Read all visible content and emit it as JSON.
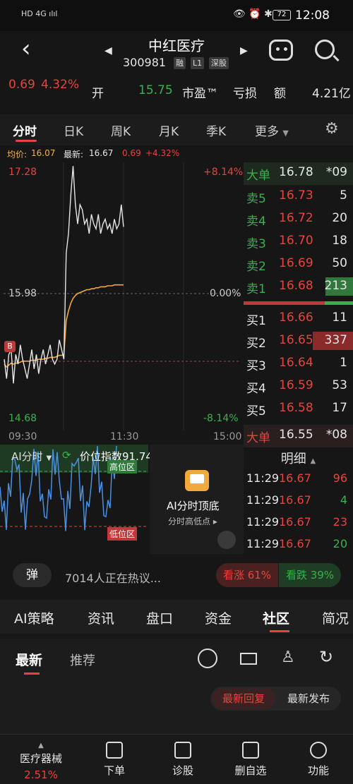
{
  "status": {
    "left_icons": "HD 4G ılıl",
    "battery": "72",
    "time": "12:08"
  },
  "header": {
    "name": "中红医疗",
    "code": "300981",
    "tags": [
      "融",
      "L1",
      "深股"
    ]
  },
  "quote": {
    "change": "0.69",
    "change_pct": "4.32%",
    "open_label": "开",
    "open_value": "15.75",
    "pe_label": "市盈™",
    "pe_value": "亏损",
    "amount_label": "额",
    "amount_value": "4.21亿"
  },
  "tabs": [
    "分时",
    "日K",
    "周K",
    "月K",
    "季K",
    "更多"
  ],
  "avg": {
    "avg_label": "均价:",
    "avg_value": "16.07",
    "latest_label": "最新:",
    "latest_value": "16.67",
    "chg": "0.69",
    "pct": "+4.32%"
  },
  "chart_data": {
    "type": "line",
    "title": "",
    "y_max": "17.28",
    "y_mid": "15.98",
    "y_min": "14.68",
    "pct_max": "+8.14%",
    "pct_mid": "0.00%",
    "pct_min": "-8.14%",
    "x_ticks": [
      "09:30",
      "11:30",
      "15:00"
    ],
    "price": [
      15.3,
      15.1,
      15.35,
      15.4,
      15.05,
      15.35,
      15.25,
      15.45,
      15.3,
      15.2,
      15.1,
      15.25,
      15.4,
      15.2,
      15.35,
      15.15,
      15.3,
      15.4,
      15.25,
      15.35,
      15.45,
      15.3,
      15.25,
      15.3,
      15.5,
      15.4,
      15.3,
      16.4,
      16.6,
      17.0,
      17.3,
      16.9,
      16.7,
      16.9,
      16.85,
      16.7,
      16.75,
      16.6,
      16.8,
      16.7,
      16.65,
      16.8,
      16.6,
      16.7,
      16.75,
      16.65,
      16.7,
      16.6,
      16.75,
      16.65,
      16.7,
      16.9,
      16.67
    ],
    "avg": [
      15.25,
      15.22,
      15.24,
      15.26,
      15.25,
      15.26,
      15.26,
      15.27,
      15.28,
      15.28,
      15.28,
      15.28,
      15.29,
      15.29,
      15.29,
      15.3,
      15.3,
      15.3,
      15.31,
      15.31,
      15.32,
      15.32,
      15.32,
      15.33,
      15.34,
      15.34,
      15.35,
      15.7,
      15.8,
      15.88,
      15.93,
      15.96,
      15.98,
      15.99,
      16.0,
      16.01,
      16.02,
      16.02,
      16.03,
      16.03,
      16.04,
      16.04,
      16.05,
      16.05,
      16.05,
      16.06,
      16.06,
      16.06,
      16.07,
      16.07,
      16.07,
      16.07,
      16.07
    ]
  },
  "orderbook": {
    "top": {
      "label": "大单",
      "price": "16.78",
      "vol": "*09"
    },
    "asks": [
      {
        "label": "卖5",
        "price": "16.73",
        "vol": "5",
        "bar": 0
      },
      {
        "label": "卖4",
        "price": "16.72",
        "vol": "20",
        "bar": 0
      },
      {
        "label": "卖3",
        "price": "16.70",
        "vol": "18",
        "bar": 0
      },
      {
        "label": "卖2",
        "price": "16.69",
        "vol": "50",
        "bar": 0
      },
      {
        "label": "卖1",
        "price": "16.68",
        "vol": "213",
        "bar": 0.25
      }
    ],
    "bids": [
      {
        "label": "买1",
        "price": "16.66",
        "vol": "11",
        "bar": 0
      },
      {
        "label": "买2",
        "price": "16.65",
        "vol": "337",
        "bar": 0.37
      },
      {
        "label": "买3",
        "price": "16.64",
        "vol": "1",
        "bar": 0
      },
      {
        "label": "买4",
        "price": "16.59",
        "vol": "53",
        "bar": 0
      },
      {
        "label": "买5",
        "price": "16.58",
        "vol": "17",
        "bar": 0
      }
    ],
    "bottom": {
      "label": "大单",
      "price": "16.55",
      "vol": "*08"
    },
    "detail_title": "明细",
    "details": [
      {
        "time": "11:29",
        "price": "16.67",
        "vol": "96"
      },
      {
        "time": "11:29",
        "price": "16.67",
        "vol": "4"
      },
      {
        "time": "11:29",
        "price": "16.67",
        "vol": "23"
      },
      {
        "time": "11:29",
        "price": "16.67",
        "vol": "20"
      }
    ]
  },
  "ai": {
    "label": "AI分时",
    "index_label": "价位指数",
    "index_value": "91.74",
    "high_zone": "高位区",
    "low_zone": "低位区",
    "promo_title": "AI分时顶底",
    "promo_sub": "时高低点",
    "promo_sub_prefix": "分"
  },
  "chat": {
    "badge": "弹",
    "text": "7014人正在热议...",
    "up": "看涨 61%",
    "down": "看跌 39%"
  },
  "bottom_tabs": [
    "AI策略",
    "资讯",
    "盘口",
    "资金",
    "社区",
    "简况"
  ],
  "community": {
    "tab_latest": "最新",
    "tab_recommend": "推荐",
    "sort_reply": "最新回复",
    "sort_post": "最新发布"
  },
  "footer": {
    "industry": "医疗器械",
    "industry_pct": "2.51%",
    "items": [
      "下单",
      "诊股",
      "删自选",
      "功能"
    ]
  }
}
